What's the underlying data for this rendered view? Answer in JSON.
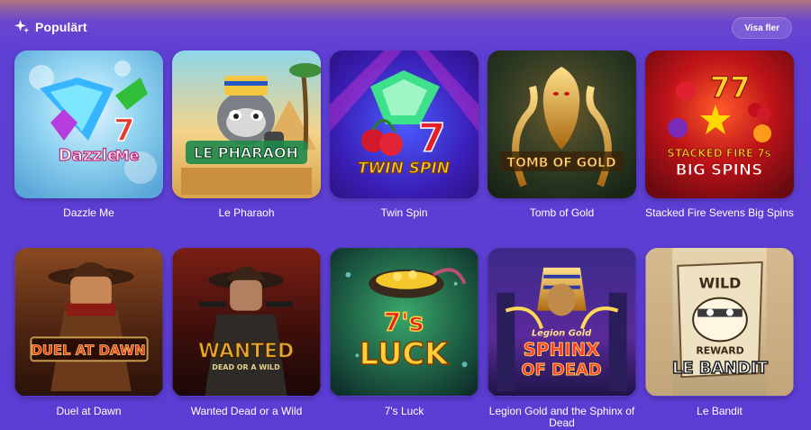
{
  "header": {
    "title": "Populärt",
    "title_icon": "sparkle-icon",
    "more_label": "Visa fler"
  },
  "colors": {
    "background": "#5b3dd3",
    "button_bg": "rgba(255,255,255,0.14)"
  },
  "games": [
    {
      "name": "Dazzle Me",
      "logo": [
        "Dazzle",
        "Me"
      ]
    },
    {
      "name": "Le Pharaoh",
      "logo": [
        "LE PHARAOH"
      ]
    },
    {
      "name": "Twin Spin",
      "logo": [
        "TWIN SPIN"
      ]
    },
    {
      "name": "Tomb of Gold",
      "logo": [
        "TOMB OF GOLD"
      ]
    },
    {
      "name": "Stacked Fire Sevens Big Spins",
      "logo": [
        "STACKED FIRE 7s",
        "BIG SPINS"
      ]
    },
    {
      "name": "Duel at Dawn",
      "logo": [
        "DUEL AT DAWN"
      ]
    },
    {
      "name": "Wanted Dead or a Wild",
      "logo": [
        "WANTED",
        "DEAD OR A WILD"
      ]
    },
    {
      "name": "7's Luck",
      "logo": [
        "7's",
        "LUCK"
      ]
    },
    {
      "name": "Legion Gold and the Sphinx of Dead",
      "logo": [
        "Legion Gold",
        "SPHINX",
        "OF DEAD"
      ]
    },
    {
      "name": "Le Bandit",
      "logo": [
        "WILD",
        "REWARD",
        "LE BANDIT"
      ]
    }
  ]
}
